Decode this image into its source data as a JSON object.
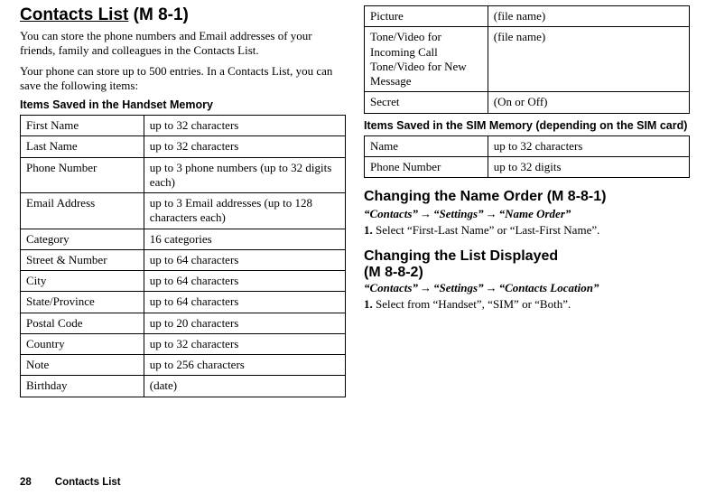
{
  "left": {
    "title_underline": "Contacts List",
    "title_suffix": " (M 8-1)",
    "intro1": "You can store the phone numbers and Email addresses of your friends, family and colleagues in the Contacts List.",
    "intro2": "Your phone can store up to 500 entries. In a Contacts List, you can save the following items:",
    "subhead": "Items Saved in the Handset Memory",
    "table": [
      {
        "k": "First Name",
        "v": "up to 32 characters"
      },
      {
        "k": "Last Name",
        "v": "up to 32 characters"
      },
      {
        "k": "Phone Number",
        "v": "up to 3 phone numbers (up to 32 digits each)"
      },
      {
        "k": "Email Address",
        "v": "up to 3 Email addresses (up to 128 characters each)"
      },
      {
        "k": "Category",
        "v": "16 categories"
      },
      {
        "k": "Street & Number",
        "v": "up to 64 characters"
      },
      {
        "k": "City",
        "v": "up to 64 characters"
      },
      {
        "k": "State/Province",
        "v": "up to 64 characters"
      },
      {
        "k": "Postal Code",
        "v": "up to 20 characters"
      },
      {
        "k": "Country",
        "v": "up to 32 characters"
      },
      {
        "k": "Note",
        "v": "up to 256 characters"
      },
      {
        "k": "Birthday",
        "v": "(date)"
      }
    ]
  },
  "right": {
    "table_top": [
      {
        "k": "Picture",
        "v": "(file name)"
      },
      {
        "k": "Tone/Video for Incoming Call\nTone/Video for New Message",
        "v": "(file name)"
      },
      {
        "k": "Secret",
        "v": "(On or Off)"
      }
    ],
    "subhead_sim": "Items Saved in the SIM Memory (depending on the SIM card)",
    "table_sim": [
      {
        "k": "Name",
        "v": "up to 32 characters"
      },
      {
        "k": "Phone Number",
        "v": "up to 32 digits"
      }
    ],
    "sec1_title": "Changing the Name Order (M 8-8-1)",
    "sec1_path": [
      "“Contacts”",
      "“Settings”",
      "“Name Order”"
    ],
    "sec1_step_num": "1.",
    "sec1_step_text": "Select “First-Last Name” or “Last-First Name”.",
    "sec2_title_line1": "Changing the List Displayed",
    "sec2_title_line2": "(M 8-8-2)",
    "sec2_path": [
      "“Contacts”",
      "“Settings”",
      "“Contacts Location”"
    ],
    "sec2_step_num": "1.",
    "sec2_step_text": "Select from “Handset”, “SIM” or “Both”."
  },
  "footer": {
    "page": "28",
    "title": "Contacts List"
  },
  "arrow": "→"
}
